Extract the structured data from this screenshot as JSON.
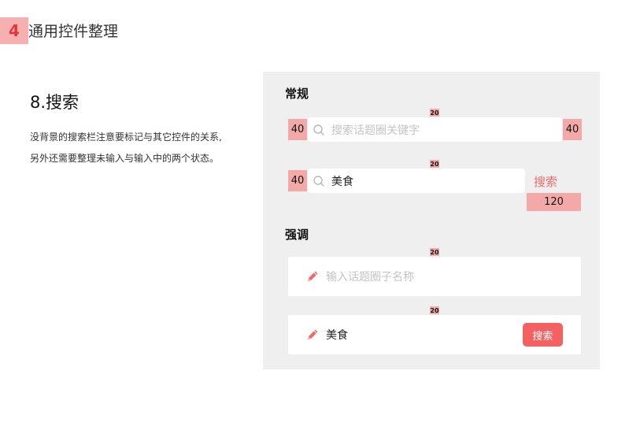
{
  "header": {
    "number": "4",
    "title": "通用控件整理"
  },
  "section": {
    "title": "8.搜索",
    "description_line1": "没背景的搜索栏注意要标记与其它控件的关系,",
    "description_line2": "另外还需要整理未输入与输入中的两个状态。"
  },
  "panel": {
    "normal_label": "常规",
    "emphasis_label": "强调",
    "normal_empty": {
      "placeholder": "搜索话题圈关键字",
      "spacing_top": "20",
      "left_margin": "40",
      "right_margin": "40"
    },
    "normal_filled": {
      "value": "美食",
      "spacing_top": "20",
      "left_margin": "40",
      "action_label": "搜索",
      "action_width": "120"
    },
    "emphasis_empty": {
      "placeholder": "输入话题圈子名称",
      "spacing_top": "20"
    },
    "emphasis_filled": {
      "value": "美食",
      "spacing_top": "20",
      "button_label": "搜索"
    }
  },
  "icons": {
    "search": "search-icon",
    "pencil": "pencil-icon"
  },
  "colors": {
    "accent": "#f56060",
    "tag": "#f4a9a9",
    "panel_bg": "#efefef"
  }
}
